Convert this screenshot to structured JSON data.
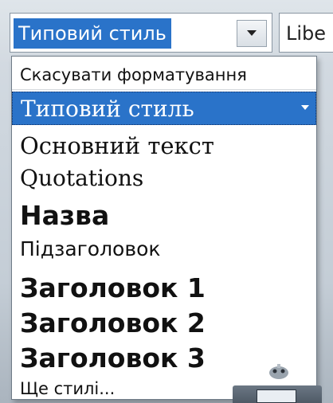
{
  "toolbar": {
    "style_value": "Типовий стиль",
    "font_value": "Libe"
  },
  "style_list": {
    "clear_formatting": "Скасувати форматування",
    "selected_style": "Типовий стиль",
    "body_text": "Основний текст",
    "quotations": "Quotations",
    "title": "Назва",
    "subtitle": "Підзаголовок",
    "heading_1": "Заголовок 1",
    "heading_2": "Заголовок 2",
    "heading_3": "Заголовок 3",
    "more_styles": "Ще стилі..."
  },
  "icons": {
    "combo_arrow": "chevron-down-icon",
    "item_menu_arrow": "chevron-down-icon"
  },
  "colors": {
    "selection": "#2a73c9",
    "selection_text": "#ffffff"
  }
}
